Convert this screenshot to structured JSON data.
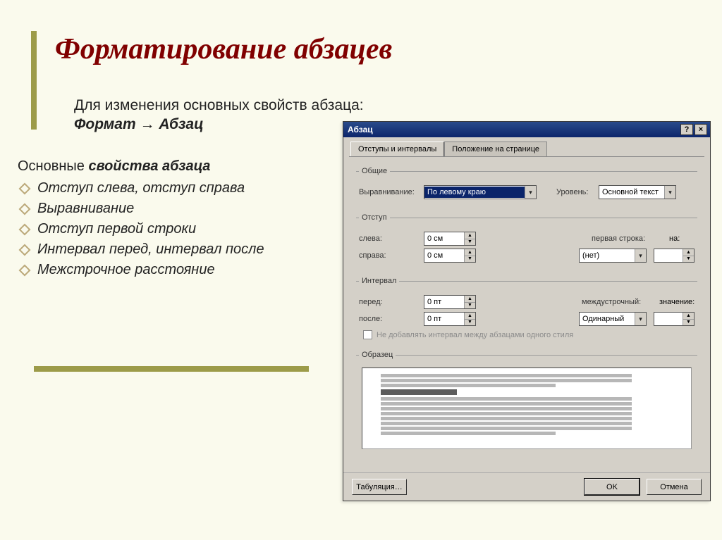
{
  "slide": {
    "title": "Форматирование абзацев",
    "intro_line1": "Для изменения основных свойств абзаца:",
    "menu_path": "Формат → Абзац",
    "props_heading_prefix": "Основные ",
    "props_heading_bold": "свойства абзаца",
    "bullets": [
      "Отступ слева, отступ справа",
      "Выравнивание",
      "Отступ первой строки",
      "Интервал перед, интервал после",
      "Межстрочное расстояние"
    ]
  },
  "dialog": {
    "title": "Абзац",
    "help_btn": "?",
    "close_btn": "×",
    "tabs": {
      "active": "Отступы и интервалы",
      "inactive": "Положение на странице"
    },
    "groups": {
      "general": {
        "legend": "Общие",
        "align_label": "Выравнивание:",
        "align_value": "По левому краю",
        "level_label": "Уровень:",
        "level_value": "Основной текст"
      },
      "indent": {
        "legend": "Отступ",
        "left_label": "слева:",
        "left_value": "0 см",
        "right_label": "справа:",
        "right_value": "0 см",
        "first_label": "первая строка:",
        "first_value": "(нет)",
        "by1_label": "на:",
        "by1_value": ""
      },
      "spacing": {
        "legend": "Интервал",
        "before_label": "перед:",
        "before_value": "0 пт",
        "after_label": "после:",
        "after_value": "0 пт",
        "line_label": "междустрочный:",
        "line_value": "Одинарный",
        "by2_label": "значение:",
        "by2_value": "",
        "no_space_same": "Не добавлять интервал между абзацами одного стиля"
      },
      "sample": {
        "legend": "Образец"
      }
    },
    "buttons": {
      "tabs": "Табуляция…",
      "ok": "OK",
      "cancel": "Отмена"
    }
  }
}
